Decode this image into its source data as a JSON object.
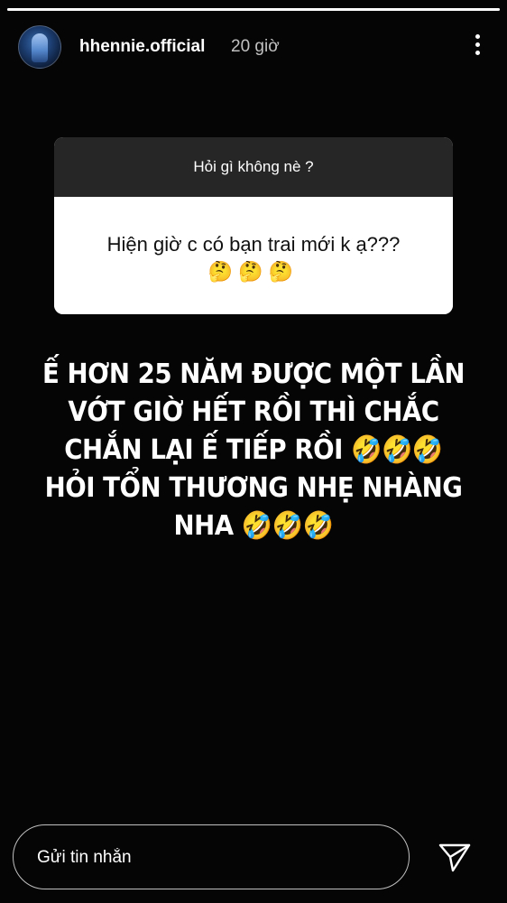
{
  "story": {
    "progress": 1.0
  },
  "header": {
    "username": "hhennie.official",
    "timestamp": "20 giờ",
    "avatar_icon": "avatar-photo",
    "more_icon": "more-vertical-icon"
  },
  "question_sticker": {
    "prompt": "Hỏi gì không nè ?",
    "question": "Hiện giờ c có bạn trai mới k ạ???",
    "emojis": "🤔🤔🤔"
  },
  "caption": {
    "lines": [
      "Ế HƠN 25 NĂM ĐƯỢC MỘT LẦN",
      "VỚT GIỜ HẾT RỒI THÌ CHẮC",
      "CHẮN LẠI Ế TIẾP RỒI 🤣🤣🤣",
      "HỎI TỔN THƯƠNG NHẸ NHÀNG",
      "NHA 🤣🤣🤣"
    ]
  },
  "reply": {
    "placeholder": "Gửi tin nhắn",
    "send_icon": "send-icon"
  },
  "colors": {
    "background": "#050505",
    "sticker_header": "#262626",
    "sticker_body": "#ffffff"
  }
}
